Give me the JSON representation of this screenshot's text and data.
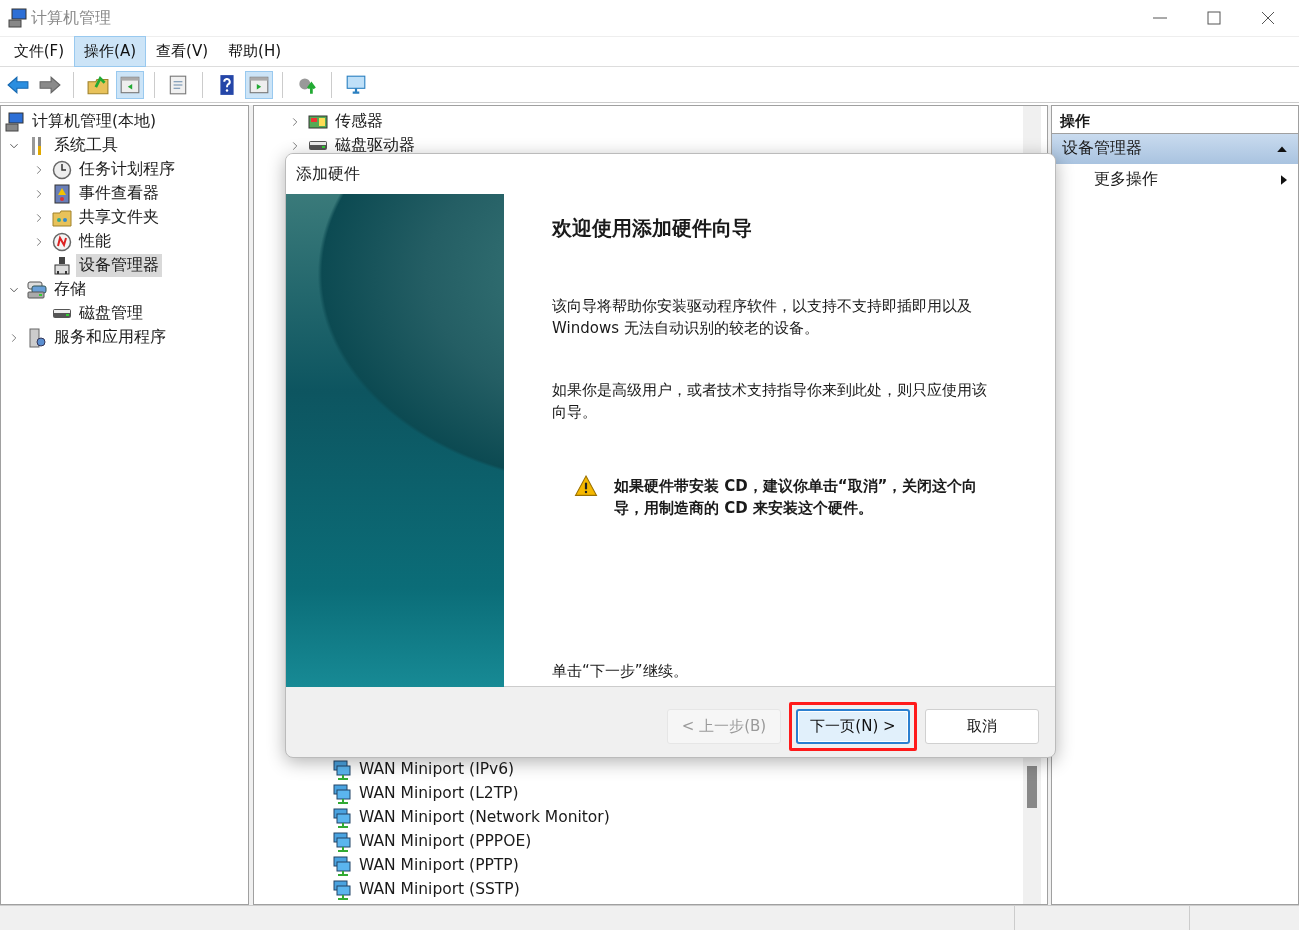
{
  "window": {
    "title": "计算机管理"
  },
  "menu": [
    {
      "label": "文件(F)",
      "selected": false
    },
    {
      "label": "操作(A)",
      "selected": true
    },
    {
      "label": "查看(V)",
      "selected": false
    },
    {
      "label": "帮助(H)",
      "selected": false
    }
  ],
  "toolbar": [
    {
      "kind": "back",
      "pressed": false
    },
    {
      "kind": "forward",
      "pressed": false
    },
    {
      "kind": "up",
      "pressed": false
    },
    {
      "kind": "tree",
      "pressed": true
    },
    {
      "kind": "properties",
      "pressed": false
    },
    {
      "kind": "help",
      "pressed": false
    },
    {
      "kind": "pane",
      "pressed": true
    },
    {
      "kind": "export",
      "pressed": false
    },
    {
      "kind": "monitor",
      "pressed": false
    }
  ],
  "tree": [
    {
      "label": "计算机管理(本地)",
      "kind": "computer",
      "selected": false,
      "children": [
        {
          "label": "系统工具",
          "kind": "tools",
          "expanded": true,
          "selected": false,
          "children": [
            {
              "label": "任务计划程序",
              "kind": "clock",
              "expanded": false,
              "selected": false
            },
            {
              "label": "事件查看器",
              "kind": "event",
              "expanded": false,
              "selected": false
            },
            {
              "label": "共享文件夹",
              "kind": "share",
              "expanded": false,
              "selected": false
            },
            {
              "label": "性能",
              "kind": "perf",
              "expanded": false,
              "selected": false
            },
            {
              "label": "设备管理器",
              "kind": "device",
              "selected": true
            }
          ]
        },
        {
          "label": "存储",
          "kind": "storage",
          "expanded": true,
          "selected": false,
          "children": [
            {
              "label": "磁盘管理",
              "kind": "disk",
              "selected": false
            }
          ]
        },
        {
          "label": "服务和应用程序",
          "kind": "services",
          "expanded": false,
          "selected": false
        }
      ]
    }
  ],
  "devices_above": [
    {
      "label": "传感器",
      "kind": "sensor",
      "expanded": false
    },
    {
      "label": "磁盘驱动器",
      "kind": "disk",
      "expanded": false
    }
  ],
  "devices_below": [
    {
      "label": "WAN Miniport (IPv6)",
      "kind": "network"
    },
    {
      "label": "WAN Miniport (L2TP)",
      "kind": "network"
    },
    {
      "label": "WAN Miniport (Network Monitor)",
      "kind": "network"
    },
    {
      "label": "WAN Miniport (PPPOE)",
      "kind": "network"
    },
    {
      "label": "WAN Miniport (PPTP)",
      "kind": "network"
    },
    {
      "label": "WAN Miniport (SSTP)",
      "kind": "network"
    }
  ],
  "actions": {
    "title": "操作",
    "section": {
      "label": "设备管理器",
      "expanded": true
    },
    "items": [
      {
        "label": "更多操作"
      }
    ]
  },
  "dialog": {
    "title": "添加硬件",
    "heading": "欢迎使用添加硬件向导",
    "paragraphs": [
      "该向导将帮助你安装驱动程序软件，以支持不支持即插即用以及 Windows 无法自动识别的较老的设备。",
      "如果你是高级用户，或者技术支持指导你来到此处，则只应使用该向导。"
    ],
    "warning": "如果硬件带安装 CD，建议你单击“取消”，关闭这个向导，用制造商的 CD 来安装这个硬件。",
    "hint": "单击“下一步”继续。",
    "buttons": [
      {
        "label": "< 上一步(B)",
        "disabled": true,
        "default": false,
        "highlighted": false
      },
      {
        "label": "下一页(N) >",
        "disabled": false,
        "default": true,
        "highlighted": true
      },
      {
        "label": "取消",
        "disabled": false,
        "default": false,
        "highlighted": false
      }
    ]
  }
}
